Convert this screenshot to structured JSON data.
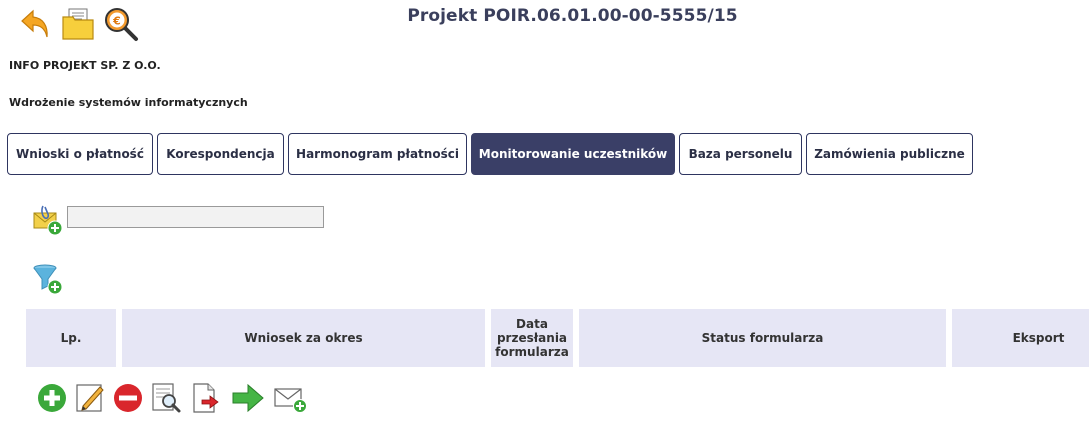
{
  "header": {
    "title": "Projekt POIR.06.01.00-00-5555/15",
    "icons": [
      "back-arrow-icon",
      "folder-icon",
      "euro-search-icon"
    ]
  },
  "organization": "INFO PROJEKT SP. Z O.O.",
  "project_name": "Wdrożenie systemów informatycznych",
  "tabs": [
    {
      "label": "Wnioski o płatność",
      "active": false
    },
    {
      "label": "Korespondencja",
      "active": false
    },
    {
      "label": "Harmonogram płatności",
      "active": false
    },
    {
      "label": "Monitorowanie uczestników",
      "active": true
    },
    {
      "label": "Baza personelu",
      "active": false
    },
    {
      "label": "Zamówienia publiczne",
      "active": false
    }
  ],
  "search": {
    "value": "",
    "placeholder": ""
  },
  "table": {
    "columns": [
      "Lp.",
      "Wniosek za okres",
      "Data przesłania formularza",
      "Status formularza",
      "Eksport"
    ],
    "rows": []
  },
  "actions": [
    "add-icon",
    "edit-icon",
    "delete-icon",
    "preview-icon",
    "export-icon",
    "send-icon",
    "message-add-icon"
  ],
  "colors": {
    "accent": "#3a3f67",
    "header_bg": "#e6e6f5",
    "title": "#3a3f5c"
  }
}
